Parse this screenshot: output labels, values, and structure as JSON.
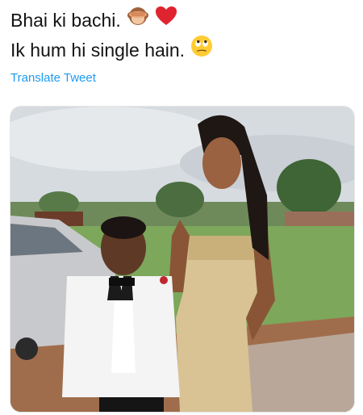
{
  "tweet": {
    "line1": "Bhai ki bachi.",
    "line2": "Ik hum hi single hain.",
    "translate_label": "Translate Tweet"
  },
  "icons": {
    "line1": [
      "see-no-evil-monkey-emoji",
      "red-heart-emoji"
    ],
    "line2": [
      "face-with-rolling-eyes-emoji"
    ]
  },
  "colors": {
    "translate_link": "#1d9bf0",
    "text": "#141414"
  }
}
